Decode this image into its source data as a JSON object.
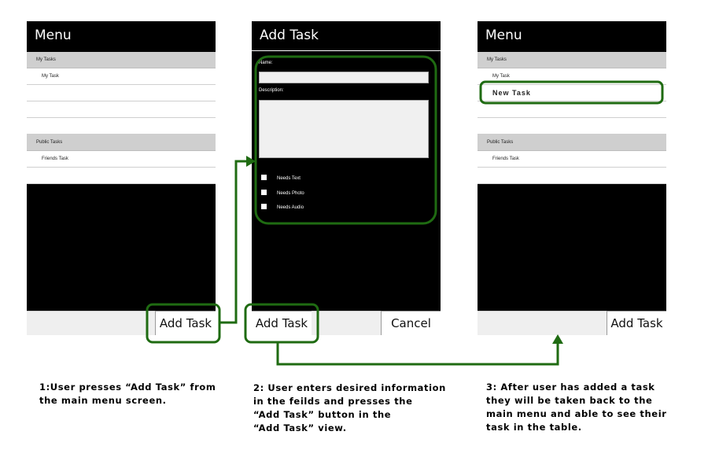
{
  "screen1": {
    "title": "Menu",
    "my_tasks_header": "My Tasks",
    "my_task_item": "My Task",
    "public_tasks_header": "Public Tasks",
    "friends_task_item": "Friends Task",
    "add_task_button": "Add Task"
  },
  "screen2": {
    "title": "Add Task",
    "name_label": "Name:",
    "description_label": "Description:",
    "needs_text": "Needs Text",
    "needs_photo": "Needs Photo",
    "needs_audio": "Needs Audio",
    "add_task_button": "Add Task",
    "cancel_button": "Cancel"
  },
  "screen3": {
    "title": "Menu",
    "my_tasks_header": "My Tasks",
    "my_task_item": "My Task",
    "new_task_item": "New Task",
    "public_tasks_header": "Public Tasks",
    "friends_task_item": "Friends Task",
    "add_task_button": "Add Task"
  },
  "captions": {
    "step1": [
      "1:User presses “Add Task” from",
      "the main menu screen."
    ],
    "step2": [
      "2: User enters desired information",
      "in the feilds and presses the",
      "“Add Task” button in the",
      "“Add Task” view."
    ],
    "step3": [
      "3: After user has added a task",
      "they will be taken back to the",
      "main menu and able to see their",
      "task in the table."
    ]
  },
  "colors": {
    "highlight": "#1f6b12",
    "screen_bg": "#000000",
    "header_row": "#cfcfcf"
  }
}
